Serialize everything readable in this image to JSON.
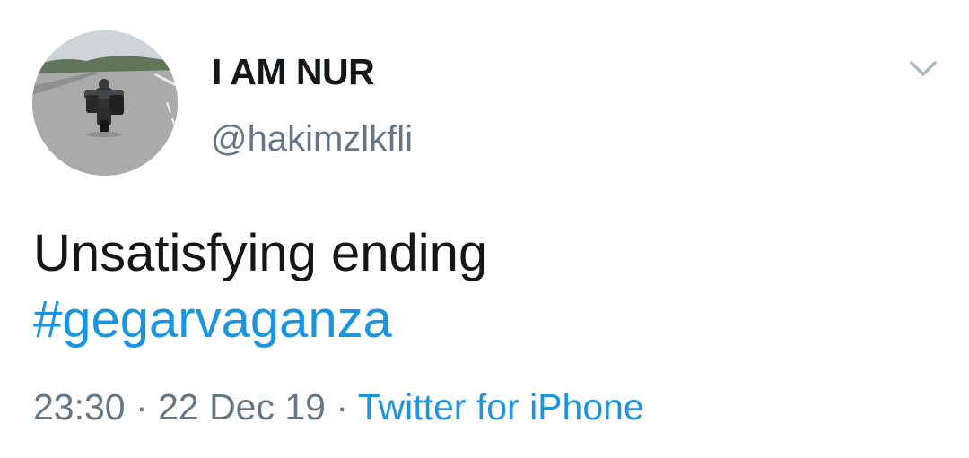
{
  "tweet": {
    "author": {
      "display_name": "I AM NUR",
      "handle": "@hakimzlkfli"
    },
    "text": "Unsatisfying ending",
    "hashtag": "#gegarvaganza",
    "time": "23:30",
    "separator": "·",
    "date": "22 Dec 19",
    "source": "Twitter for iPhone",
    "menu_icon": "chevron-down-icon"
  },
  "colors": {
    "text": "#14171a",
    "secondary": "#657786",
    "link": "#1b95e0",
    "icon": "#aab8c2"
  }
}
